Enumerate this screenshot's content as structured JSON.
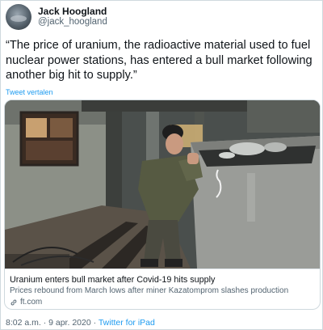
{
  "author": {
    "display_name": "Jack Hoogland",
    "handle": "@jack_hoogland"
  },
  "tweet": {
    "text": "“The price of uranium, the radioactive material used to fuel nuclear power stations, has entered a bull market following another big hit to supply.”",
    "translate_label": "Tweet vertalen"
  },
  "card": {
    "image_icon": "miner-pushing-ore-cart-photo",
    "title": "Uranium enters bull market after Covid-19 hits supply",
    "description": "Prices rebound from March lows after miner Kazatomprom slashes production",
    "domain": "ft.com",
    "domain_icon": "link-icon"
  },
  "meta": {
    "time": "8:02 a.m.",
    "separator": "·",
    "date": "9 apr. 2020",
    "separator2": "·",
    "source": "Twitter for iPad"
  },
  "colors": {
    "link": "#1d9bf0",
    "secondary_text": "#536471",
    "border": "#cfd9de"
  }
}
